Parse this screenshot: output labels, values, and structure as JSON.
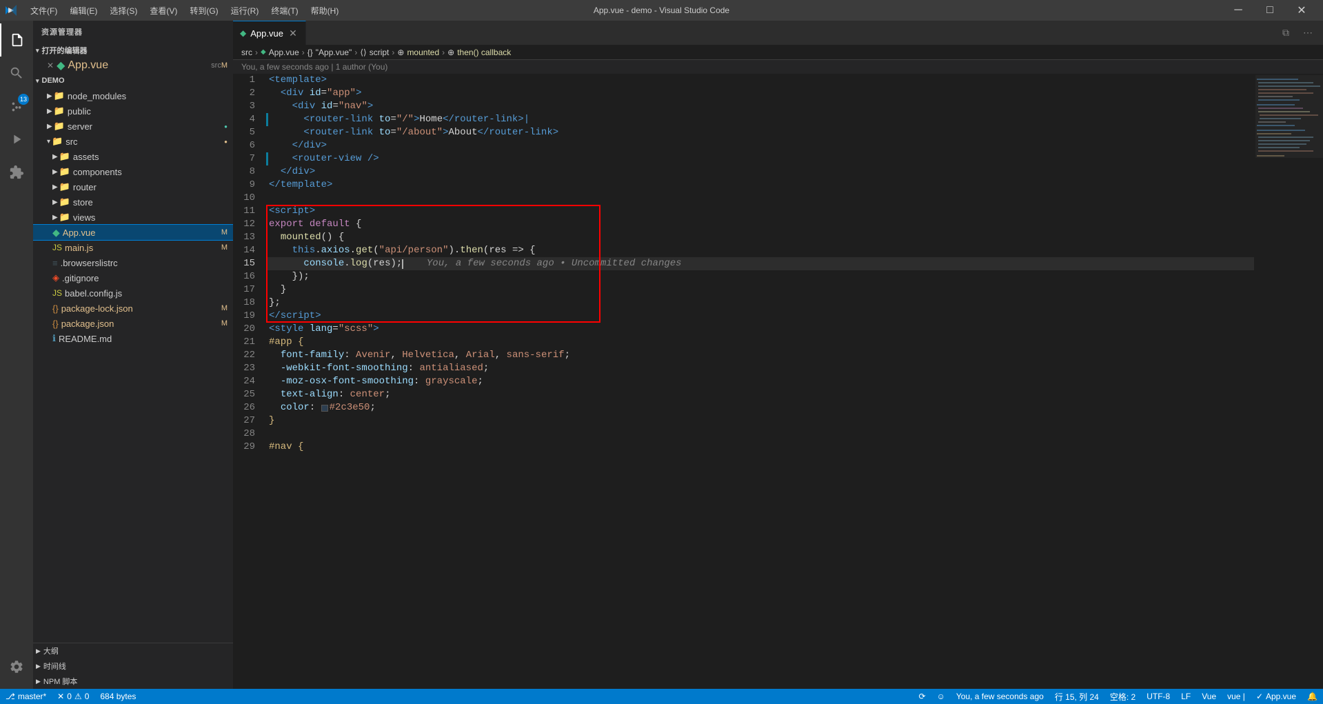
{
  "titleBar": {
    "title": "App.vue - demo - Visual Studio Code",
    "menus": [
      "文件(F)",
      "编辑(E)",
      "选择(S)",
      "查看(V)",
      "转到(G)",
      "运行(R)",
      "终端(T)",
      "帮助(H)"
    ],
    "buttons": {
      "minimize": "─",
      "maximize": "□",
      "close": "✕"
    }
  },
  "sidebar": {
    "header": "资源管理器",
    "openEditors": {
      "label": "打开的编辑器",
      "files": [
        {
          "name": "App.vue",
          "path": "src",
          "badge": "M",
          "icon": "vue"
        }
      ]
    },
    "projectName": "DEMO",
    "tree": [
      {
        "level": 0,
        "type": "folder",
        "name": "node_modules",
        "expanded": false
      },
      {
        "level": 0,
        "type": "folder",
        "name": "public",
        "expanded": false
      },
      {
        "level": 0,
        "type": "folder",
        "name": "server",
        "expanded": false,
        "dot": "green"
      },
      {
        "level": 0,
        "type": "folder",
        "name": "src",
        "expanded": true,
        "dot": "orange"
      },
      {
        "level": 1,
        "type": "folder",
        "name": "assets",
        "expanded": false
      },
      {
        "level": 1,
        "type": "folder",
        "name": "components",
        "expanded": false
      },
      {
        "level": 1,
        "type": "folder",
        "name": "router",
        "expanded": false
      },
      {
        "level": 1,
        "type": "folder",
        "name": "store",
        "expanded": false
      },
      {
        "level": 1,
        "type": "folder",
        "name": "views",
        "expanded": false
      },
      {
        "level": 1,
        "type": "vue",
        "name": "App.vue",
        "badge": "M",
        "selected": true
      },
      {
        "level": 1,
        "type": "js",
        "name": "main.js",
        "badge": "M"
      },
      {
        "level": 0,
        "type": "file",
        "name": ".browserslistrc",
        "icon": "config"
      },
      {
        "level": 0,
        "type": "file",
        "name": ".gitignore",
        "icon": "git"
      },
      {
        "level": 0,
        "type": "json",
        "name": "babel.config.js",
        "icon": "babel"
      },
      {
        "level": 0,
        "type": "json",
        "name": "package-lock.json",
        "badge": "M",
        "icon": "json"
      },
      {
        "level": 0,
        "type": "json",
        "name": "package.json",
        "badge": "M",
        "icon": "json"
      },
      {
        "level": 0,
        "type": "file",
        "name": "README.md",
        "icon": "readme"
      }
    ],
    "bottomSections": [
      {
        "label": "大纲"
      },
      {
        "label": "时间线"
      },
      {
        "label": "NPM 脚本"
      }
    ]
  },
  "tabs": [
    {
      "name": "App.vue",
      "icon": "vue",
      "active": true,
      "modified": false
    }
  ],
  "breadcrumb": {
    "parts": [
      "src",
      "App.vue",
      "script",
      "mounted",
      "then() callback"
    ]
  },
  "gitBlame": "You, a few seconds ago | 1 author (You)",
  "editor": {
    "lines": [
      {
        "num": 1,
        "tokens": [
          {
            "t": "<",
            "c": "s-tag"
          },
          {
            "t": "template",
            "c": "s-tag"
          },
          {
            "t": ">",
            "c": "s-tag"
          }
        ]
      },
      {
        "num": 2,
        "tokens": [
          {
            "t": "  ",
            "c": "s-text"
          },
          {
            "t": "<",
            "c": "s-tag"
          },
          {
            "t": "div",
            "c": "s-tag"
          },
          {
            "t": " ",
            "c": "s-text"
          },
          {
            "t": "id",
            "c": "s-attr"
          },
          {
            "t": "=",
            "c": "s-punct"
          },
          {
            "t": "\"app\"",
            "c": "s-val"
          },
          {
            "t": ">",
            "c": "s-tag"
          }
        ]
      },
      {
        "num": 3,
        "tokens": [
          {
            "t": "    ",
            "c": "s-text"
          },
          {
            "t": "<",
            "c": "s-tag"
          },
          {
            "t": "div",
            "c": "s-tag"
          },
          {
            "t": " ",
            "c": "s-text"
          },
          {
            "t": "id",
            "c": "s-attr"
          },
          {
            "t": "=",
            "c": "s-punct"
          },
          {
            "t": "\"nav\"",
            "c": "s-val"
          },
          {
            "t": ">",
            "c": "s-tag"
          }
        ]
      },
      {
        "num": 4,
        "tokens": [
          {
            "t": "      ",
            "c": "s-text"
          },
          {
            "t": "<",
            "c": "s-tag"
          },
          {
            "t": "router-link",
            "c": "s-tag"
          },
          {
            "t": " ",
            "c": "s-text"
          },
          {
            "t": "to",
            "c": "s-attr"
          },
          {
            "t": "=",
            "c": "s-punct"
          },
          {
            "t": "\"/\"",
            "c": "s-val"
          },
          {
            "t": ">",
            "c": "s-tag"
          },
          {
            "t": "Home",
            "c": "s-text"
          },
          {
            "t": "</",
            "c": "s-tag"
          },
          {
            "t": "router-link",
            "c": "s-tag"
          },
          {
            "t": ">|",
            "c": "s-tag"
          }
        ],
        "gitBar": true
      },
      {
        "num": 5,
        "tokens": [
          {
            "t": "      ",
            "c": "s-text"
          },
          {
            "t": "<",
            "c": "s-tag"
          },
          {
            "t": "router-link",
            "c": "s-tag"
          },
          {
            "t": " ",
            "c": "s-text"
          },
          {
            "t": "to",
            "c": "s-attr"
          },
          {
            "t": "=",
            "c": "s-punct"
          },
          {
            "t": "\"/about\"",
            "c": "s-val"
          },
          {
            "t": ">",
            "c": "s-tag"
          },
          {
            "t": "About",
            "c": "s-text"
          },
          {
            "t": "</",
            "c": "s-tag"
          },
          {
            "t": "router-link",
            "c": "s-tag"
          },
          {
            "t": ">",
            "c": "s-tag"
          }
        ]
      },
      {
        "num": 6,
        "tokens": [
          {
            "t": "    ",
            "c": "s-text"
          },
          {
            "t": "</",
            "c": "s-tag"
          },
          {
            "t": "div",
            "c": "s-tag"
          },
          {
            "t": ">",
            "c": "s-tag"
          }
        ]
      },
      {
        "num": 7,
        "tokens": [
          {
            "t": "    ",
            "c": "s-text"
          },
          {
            "t": "<",
            "c": "s-tag"
          },
          {
            "t": "router-view",
            "c": "s-tag"
          },
          {
            "t": " />",
            "c": "s-tag"
          }
        ],
        "gitBar": true
      },
      {
        "num": 8,
        "tokens": [
          {
            "t": "  ",
            "c": "s-text"
          },
          {
            "t": "</",
            "c": "s-tag"
          },
          {
            "t": "div",
            "c": "s-tag"
          },
          {
            "t": ">",
            "c": "s-tag"
          }
        ]
      },
      {
        "num": 9,
        "tokens": [
          {
            "t": "</",
            "c": "s-tag"
          },
          {
            "t": "template",
            "c": "s-tag"
          },
          {
            "t": ">",
            "c": "s-tag"
          }
        ]
      },
      {
        "num": 10,
        "tokens": []
      },
      {
        "num": 11,
        "tokens": [
          {
            "t": "<",
            "c": "s-tag"
          },
          {
            "t": "script",
            "c": "s-tag"
          },
          {
            "t": ">",
            "c": "s-tag"
          }
        ]
      },
      {
        "num": 12,
        "tokens": [
          {
            "t": "export ",
            "c": "s-keyword"
          },
          {
            "t": "default",
            "c": "s-keyword"
          },
          {
            "t": " {",
            "c": "s-text"
          }
        ]
      },
      {
        "num": 13,
        "tokens": [
          {
            "t": "  ",
            "c": "s-text"
          },
          {
            "t": "mounted",
            "c": "s-func"
          },
          {
            "t": "() {",
            "c": "s-text"
          }
        ]
      },
      {
        "num": 14,
        "tokens": [
          {
            "t": "    ",
            "c": "s-text"
          },
          {
            "t": "this",
            "c": "s-keyword2"
          },
          {
            "t": ".",
            "c": "s-punct"
          },
          {
            "t": "axios",
            "c": "s-prop"
          },
          {
            "t": ".",
            "c": "s-punct"
          },
          {
            "t": "get",
            "c": "s-method"
          },
          {
            "t": "(",
            "c": "s-text"
          },
          {
            "t": "\"api/person\"",
            "c": "s-str"
          },
          {
            "t": ").",
            "c": "s-text"
          },
          {
            "t": "then",
            "c": "s-method"
          },
          {
            "t": "(",
            "c": "s-text"
          },
          {
            "t": "res",
            "c": "s-var"
          },
          {
            "t": " => {",
            "c": "s-text"
          }
        ]
      },
      {
        "num": 15,
        "tokens": [
          {
            "t": "      ",
            "c": "s-text"
          },
          {
            "t": "console",
            "c": "s-prop"
          },
          {
            "t": ".",
            "c": "s-punct"
          },
          {
            "t": "log",
            "c": "s-method"
          },
          {
            "t": "(",
            "c": "s-text"
          },
          {
            "t": "res",
            "c": "s-var"
          },
          {
            "t": ") ;",
            "c": "s-text"
          }
        ],
        "cursor": true,
        "ghostText": "    You, a few seconds ago • Uncommitted changes"
      },
      {
        "num": 16,
        "tokens": [
          {
            "t": "    ",
            "c": "s-text"
          },
          {
            "t": "});",
            "c": "s-text"
          }
        ]
      },
      {
        "num": 17,
        "tokens": [
          {
            "t": "  ",
            "c": "s-text"
          },
          {
            "t": "}",
            "c": "s-text"
          }
        ]
      },
      {
        "num": 18,
        "tokens": [
          {
            "t": "};",
            "c": "s-text"
          }
        ]
      },
      {
        "num": 19,
        "tokens": [
          {
            "t": "</",
            "c": "s-tag"
          },
          {
            "t": "script",
            "c": "s-tag"
          },
          {
            "t": ">",
            "c": "s-tag"
          }
        ]
      },
      {
        "num": 20,
        "tokens": [
          {
            "t": "<",
            "c": "s-tag"
          },
          {
            "t": "style",
            "c": "s-tag"
          },
          {
            "t": " ",
            "c": "s-text"
          },
          {
            "t": "lang",
            "c": "s-attr"
          },
          {
            "t": "=",
            "c": "s-punct"
          },
          {
            "t": "\"scss\"",
            "c": "s-val"
          },
          {
            "t": ">",
            "c": "s-tag"
          }
        ]
      },
      {
        "num": 21,
        "tokens": [
          {
            "t": "#app {",
            "c": "s-selector"
          }
        ]
      },
      {
        "num": 22,
        "tokens": [
          {
            "t": "  ",
            "c": "s-text"
          },
          {
            "t": "font-family",
            "c": "s-css-prop"
          },
          {
            "t": ": ",
            "c": "s-text"
          },
          {
            "t": "Avenir",
            "c": "s-css-val"
          },
          {
            "t": ", ",
            "c": "s-text"
          },
          {
            "t": "Helvetica",
            "c": "s-css-val"
          },
          {
            "t": ", ",
            "c": "s-text"
          },
          {
            "t": "Arial",
            "c": "s-css-val"
          },
          {
            "t": ", ",
            "c": "s-text"
          },
          {
            "t": "sans-serif",
            "c": "s-css-val"
          },
          {
            "t": ";",
            "c": "s-text"
          }
        ]
      },
      {
        "num": 23,
        "tokens": [
          {
            "t": "  ",
            "c": "s-text"
          },
          {
            "t": "-webkit-font-smoothing",
            "c": "s-css-prop"
          },
          {
            "t": ": ",
            "c": "s-text"
          },
          {
            "t": "antialiased",
            "c": "s-css-val"
          },
          {
            "t": ";",
            "c": "s-text"
          }
        ]
      },
      {
        "num": 24,
        "tokens": [
          {
            "t": "  ",
            "c": "s-text"
          },
          {
            "t": "-moz-osx-font-smoothing",
            "c": "s-css-prop"
          },
          {
            "t": ": ",
            "c": "s-text"
          },
          {
            "t": "grayscale",
            "c": "s-css-val"
          },
          {
            "t": ";",
            "c": "s-text"
          }
        ]
      },
      {
        "num": 25,
        "tokens": [
          {
            "t": "  ",
            "c": "s-text"
          },
          {
            "t": "text-align",
            "c": "s-css-prop"
          },
          {
            "t": ": ",
            "c": "s-text"
          },
          {
            "t": "center",
            "c": "s-css-val"
          },
          {
            "t": ";",
            "c": "s-text"
          }
        ]
      },
      {
        "num": 26,
        "tokens": [
          {
            "t": "  ",
            "c": "s-text"
          },
          {
            "t": "color",
            "c": "s-css-prop"
          },
          {
            "t": ": ",
            "c": "s-text"
          },
          {
            "t": "SWATCH",
            "c": "s-special"
          },
          {
            "t": "#2c3e50",
            "c": "s-css-val"
          },
          {
            "t": ";",
            "c": "s-text"
          }
        ]
      },
      {
        "num": 27,
        "tokens": [
          {
            "t": "}",
            "c": "s-selector"
          }
        ]
      },
      {
        "num": 28,
        "tokens": []
      },
      {
        "num": 29,
        "tokens": [
          {
            "t": "#nav {",
            "c": "s-selector"
          }
        ]
      }
    ]
  },
  "statusBar": {
    "git": "master*",
    "errors": "0",
    "warnings": "0",
    "size": "684 bytes",
    "language": "Vue",
    "encoding": "UTF-8",
    "lineEnding": "LF",
    "position": "行 15, 列 24",
    "spaces": "空格: 2",
    "indent": "vue |",
    "check": "✓ App.vue",
    "git_icon": "⎇",
    "sync_icon": "🔄"
  }
}
